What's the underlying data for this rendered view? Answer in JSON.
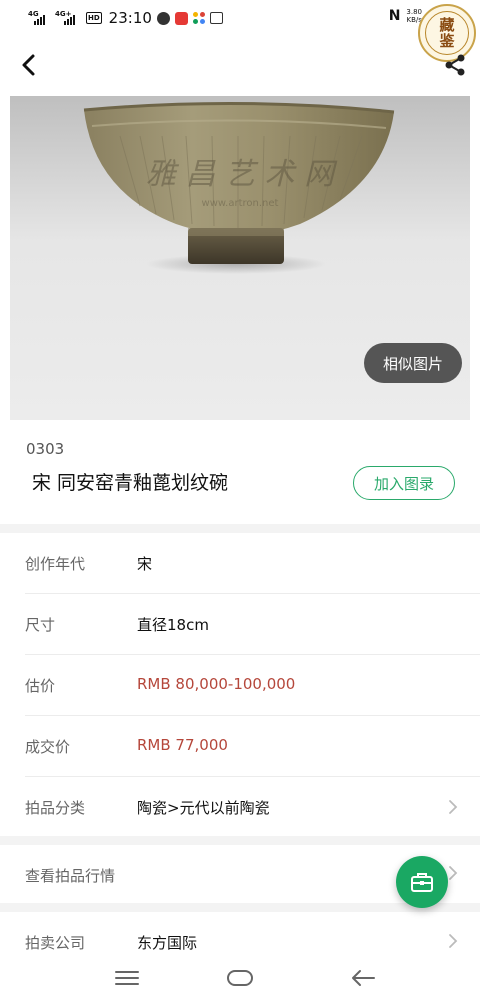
{
  "status_bar": {
    "signal1": "4G",
    "signal2": "4G+",
    "hd_label": "HD",
    "time": "23:10",
    "nfc": "N",
    "speed_value": "3.80",
    "speed_unit": "KB/s"
  },
  "header": {
    "seal_line1": "藏",
    "seal_line2": "鉴"
  },
  "hero": {
    "similar_button": "相似图片"
  },
  "item": {
    "lot_number": "0303",
    "title": "宋 同安窑青釉蓖划纹碗",
    "catalog_button": "加入图录"
  },
  "details": [
    {
      "label": "创作年代",
      "value": "宋",
      "highlight": false,
      "link": false
    },
    {
      "label": "尺寸",
      "value": "直径18cm",
      "highlight": false,
      "link": false
    },
    {
      "label": "估价",
      "value": "RMB  80,000-100,000",
      "highlight": true,
      "link": false
    },
    {
      "label": "成交价",
      "value": "RMB 77,000",
      "highlight": true,
      "link": false
    },
    {
      "label": "拍品分类",
      "value": "陶瓷>元代以前陶瓷",
      "highlight": false,
      "link": true
    }
  ],
  "market": {
    "label": "查看拍品行情"
  },
  "company": {
    "label": "拍卖公司",
    "value": "东方国际"
  },
  "colors": {
    "accent_green": "#1aa863",
    "price_red": "#b5473b"
  }
}
